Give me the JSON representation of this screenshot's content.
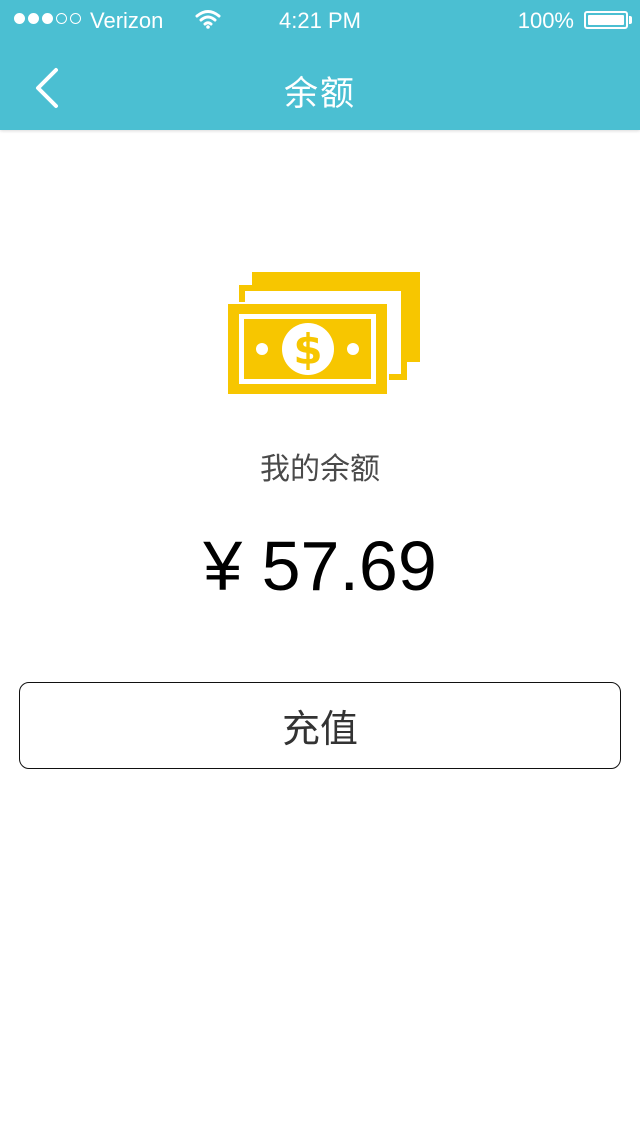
{
  "status_bar": {
    "carrier": "Verizon",
    "time": "4:21 PM",
    "battery_percent": "100%",
    "signal_filled": 3,
    "signal_total": 5
  },
  "nav": {
    "title": "余额",
    "back_icon": "chevron-left-icon"
  },
  "main": {
    "icon": "money-stack-icon",
    "icon_color": "#f7c600",
    "balance_label": "我的余额",
    "balance_amount": "¥ 57.69",
    "recharge_label": "充值"
  },
  "colors": {
    "accent": "#4bbfd2",
    "text_primary": "#000000",
    "text_secondary": "#4a4a4a"
  }
}
